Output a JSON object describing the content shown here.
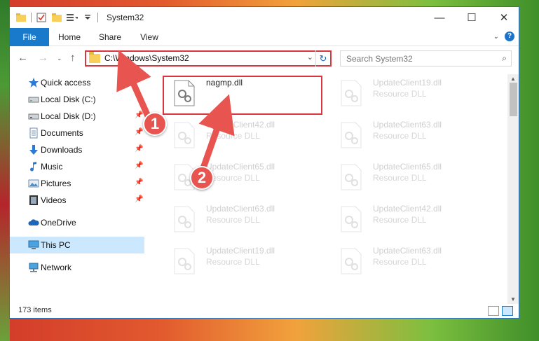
{
  "window": {
    "title": "System32",
    "controls": {
      "minimize": "—",
      "maximize": "☐",
      "close": "✕"
    }
  },
  "ribbon": {
    "tabs": [
      "File",
      "Home",
      "Share",
      "View"
    ]
  },
  "address": {
    "path": "C:\\Windows\\System32",
    "search_placeholder": "Search System32"
  },
  "sidebar": {
    "items": [
      {
        "label": "Quick access",
        "icon": "star-icon",
        "pinned": false
      },
      {
        "label": "Local Disk (C:)",
        "icon": "drive-icon",
        "pinned": false
      },
      {
        "label": "Local Disk (D:)",
        "icon": "drive-icon",
        "pinned": true
      },
      {
        "label": "Documents",
        "icon": "documents-icon",
        "pinned": true
      },
      {
        "label": "Downloads",
        "icon": "download-icon",
        "pinned": true
      },
      {
        "label": "Music",
        "icon": "music-icon",
        "pinned": true
      },
      {
        "label": "Pictures",
        "icon": "pictures-icon",
        "pinned": true
      },
      {
        "label": "Videos",
        "icon": "videos-icon",
        "pinned": true
      },
      {
        "label": "OneDrive",
        "icon": "cloud-icon",
        "pinned": false
      },
      {
        "label": "This PC",
        "icon": "computer-icon",
        "pinned": false,
        "selected": true
      },
      {
        "label": "Network",
        "icon": "network-icon",
        "pinned": false
      }
    ]
  },
  "files": [
    {
      "name": "nagmp.dll",
      "type": "",
      "highlighted": true
    },
    {
      "name": "UpdateClient19.dll",
      "type": "Resource DLL",
      "highlighted": false
    },
    {
      "name": "UpdateClient42.dll",
      "type": "Resource DLL",
      "highlighted": false
    },
    {
      "name": "UpdateClient63.dll",
      "type": "Resource DLL",
      "highlighted": false
    },
    {
      "name": "UpdateClient65.dll",
      "type": "Resource DLL",
      "highlighted": false
    },
    {
      "name": "UpdateClient65.dll",
      "type": "Resource DLL",
      "highlighted": false
    },
    {
      "name": "UpdateClient63.dll",
      "type": "Resource DLL",
      "highlighted": false
    },
    {
      "name": "UpdateClient42.dll",
      "type": "Resource DLL",
      "highlighted": false
    },
    {
      "name": "UpdateClient19.dll",
      "type": "Resource DLL",
      "highlighted": false
    },
    {
      "name": "UpdateClient63.dll",
      "type": "Resource DLL",
      "highlighted": false
    }
  ],
  "status": {
    "item_count": "173 items"
  },
  "annotations": {
    "step1": "1",
    "step2": "2",
    "color": "#e8544f"
  }
}
